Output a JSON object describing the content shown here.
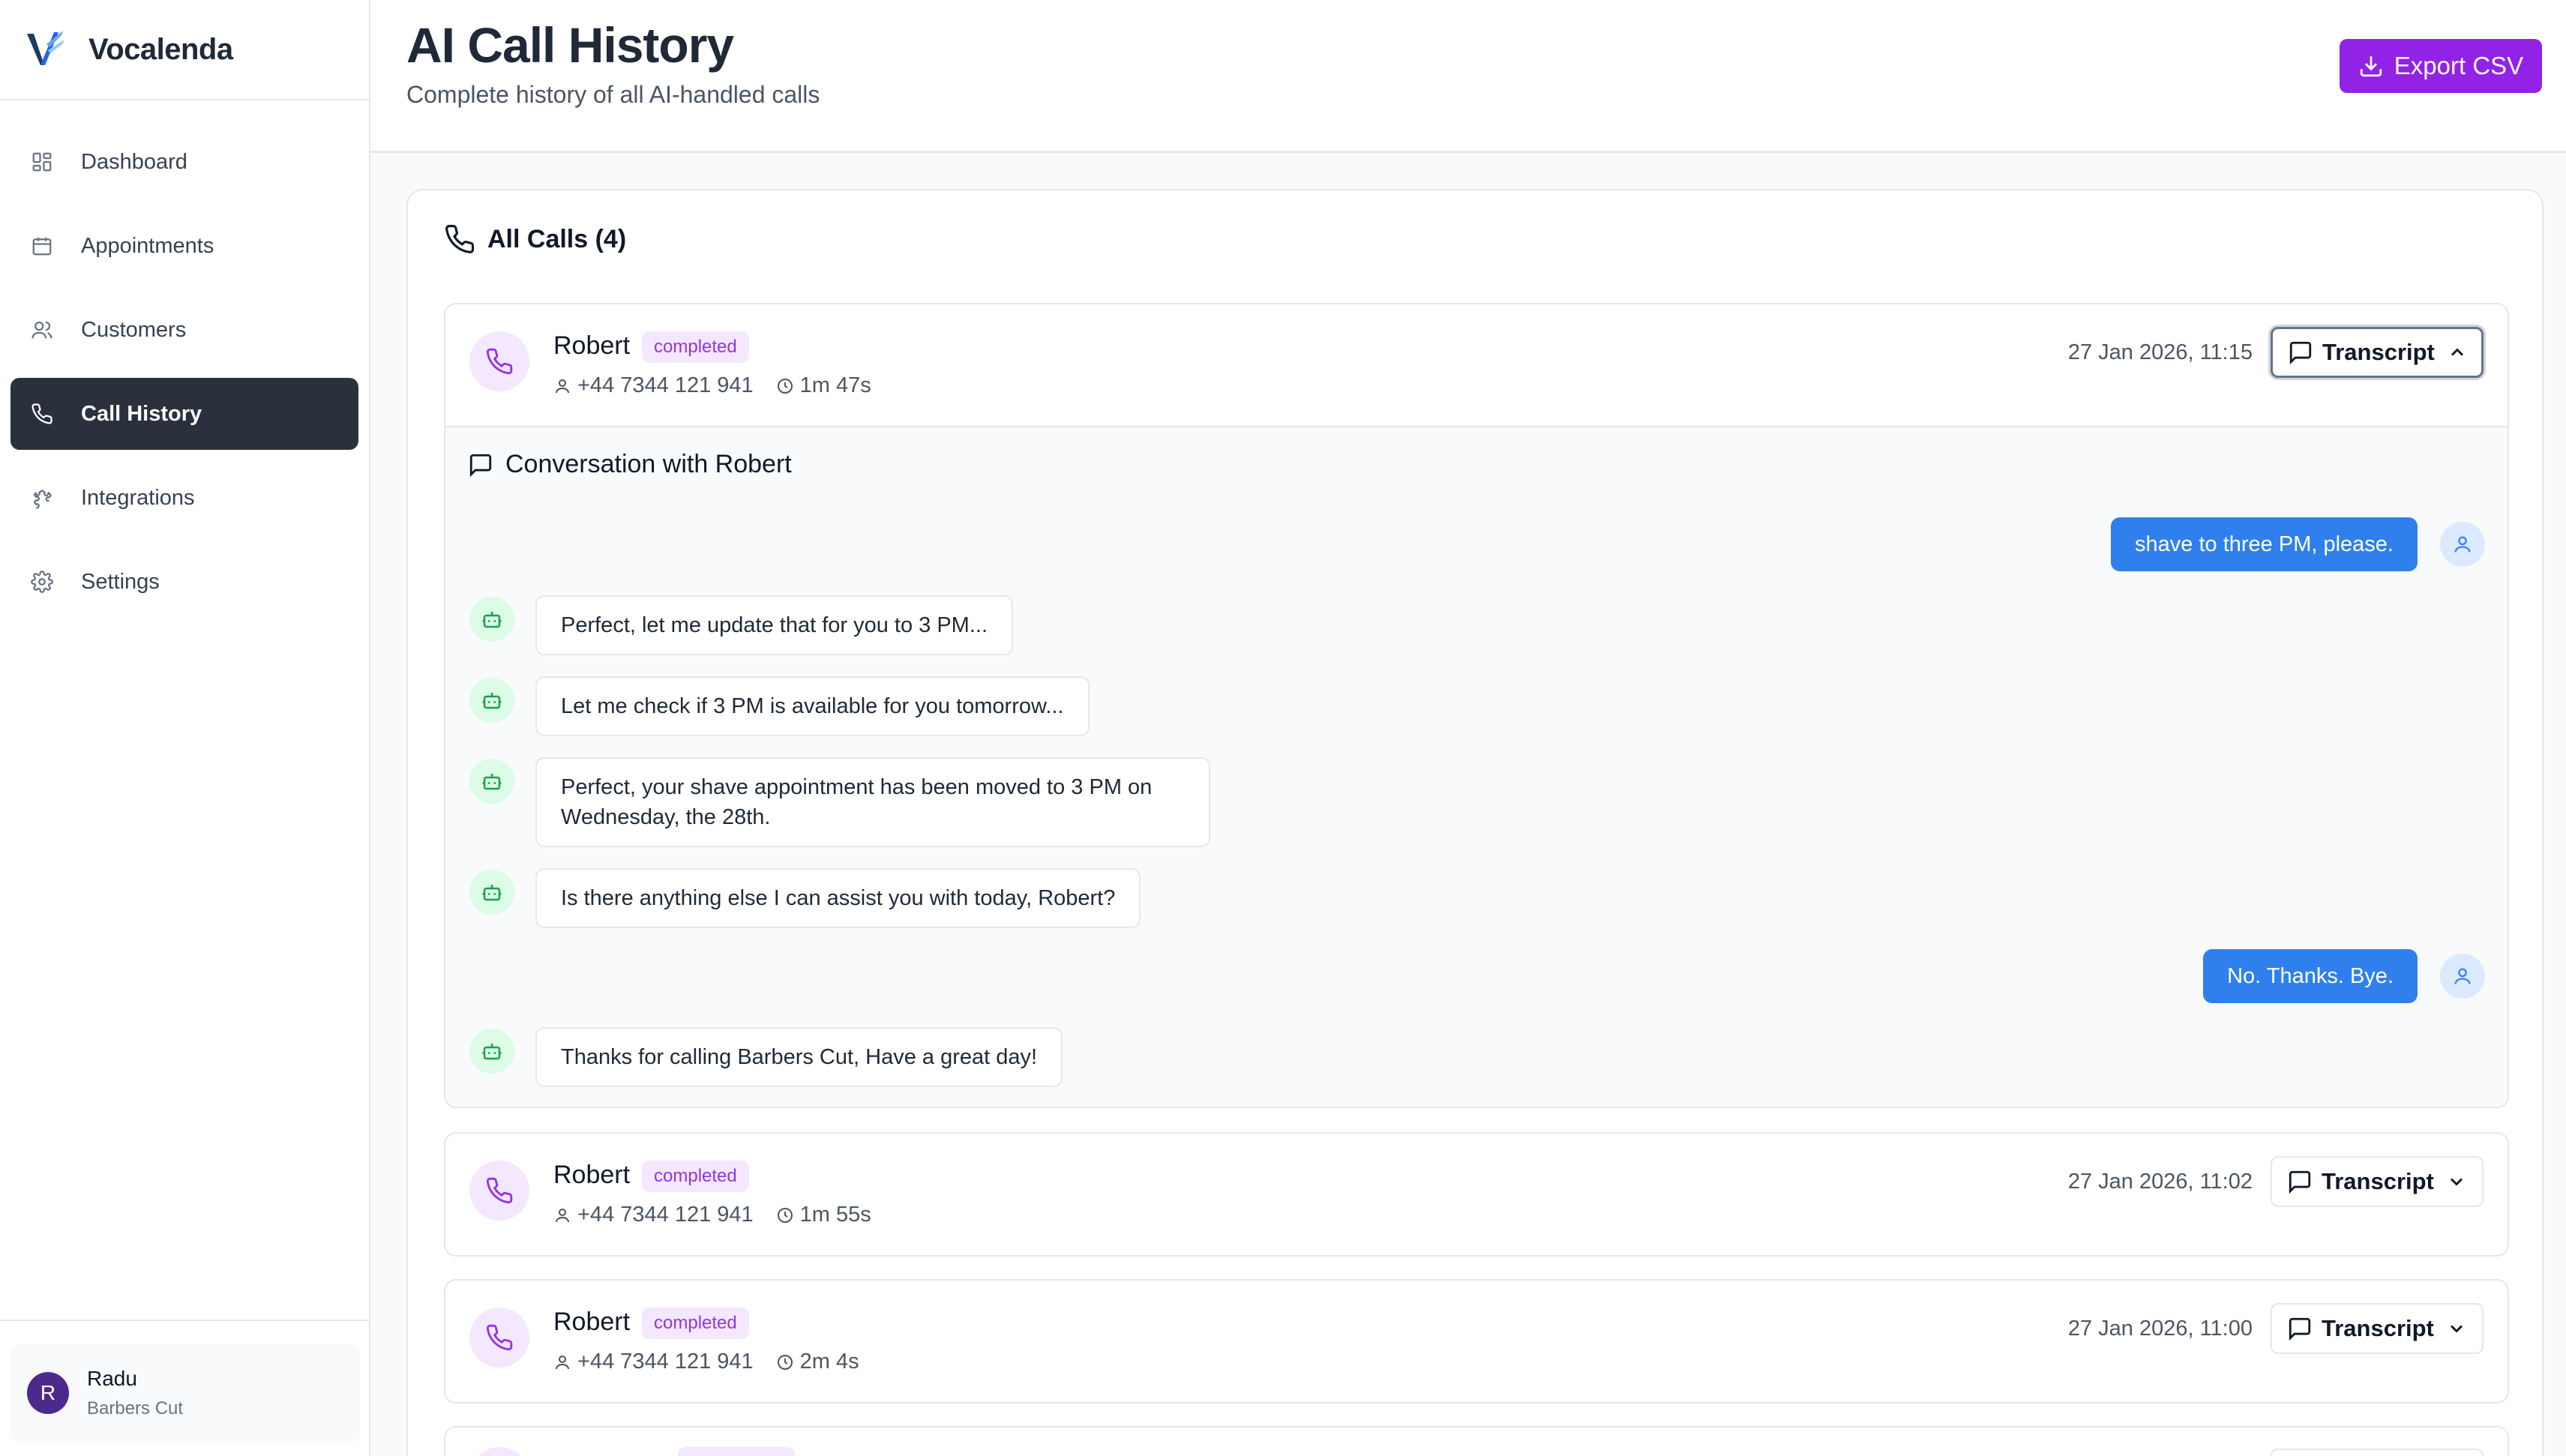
{
  "app": {
    "name": "Vocalenda"
  },
  "sidebar": {
    "items": [
      {
        "label": "Dashboard",
        "icon": "grid-icon"
      },
      {
        "label": "Appointments",
        "icon": "calendar-icon"
      },
      {
        "label": "Customers",
        "icon": "users-icon"
      },
      {
        "label": "Call History",
        "icon": "phone-icon",
        "active": true
      },
      {
        "label": "Integrations",
        "icon": "puzzle-icon"
      },
      {
        "label": "Settings",
        "icon": "gear-icon"
      }
    ],
    "user": {
      "initial": "R",
      "name": "Radu",
      "business": "Barbers Cut"
    }
  },
  "header": {
    "title": "AI Call History",
    "subtitle": "Complete history of all AI-handled calls",
    "export_label": "Export CSV"
  },
  "calls_card": {
    "title": "All Calls (4)",
    "transcript_label": "Transcript",
    "calls": [
      {
        "name": "Robert",
        "status": "completed",
        "phone": "+44 7344 121 941",
        "duration": "1m 47s",
        "date": "27 Jan 2026, 11:15",
        "expanded": true
      },
      {
        "name": "Robert",
        "status": "completed",
        "phone": "+44 7344 121 941",
        "duration": "1m 55s",
        "date": "27 Jan 2026, 11:02",
        "expanded": false
      },
      {
        "name": "Robert",
        "status": "completed",
        "phone": "+44 7344 121 941",
        "duration": "2m 4s",
        "date": "27 Jan 2026, 11:00",
        "expanded": false
      }
    ],
    "conversation": {
      "title": "Conversation with Robert",
      "messages": [
        {
          "role": "user",
          "text": "shave to three PM, please."
        },
        {
          "role": "ai",
          "text": "Perfect, let me update that for you to 3 PM..."
        },
        {
          "role": "ai",
          "text": "Let me check if 3 PM is available for you tomorrow..."
        },
        {
          "role": "ai",
          "text": "Perfect, your shave appointment has been moved to 3 PM on Wednesday, the 28th."
        },
        {
          "role": "ai",
          "text": "Is there anything else I can assist you with today, Robert?"
        },
        {
          "role": "user",
          "text": "No. Thanks. Bye."
        },
        {
          "role": "ai",
          "text": "Thanks for calling Barbers Cut, Have a great day!"
        }
      ]
    }
  },
  "colors": {
    "accent": "#9222e6",
    "sidebar_active": "#2a313d",
    "user_bubble": "#2f80ed",
    "badge_bg": "#f3e8ff",
    "badge_text": "#9333ea",
    "bot_icon_bg": "#dcfce7"
  }
}
